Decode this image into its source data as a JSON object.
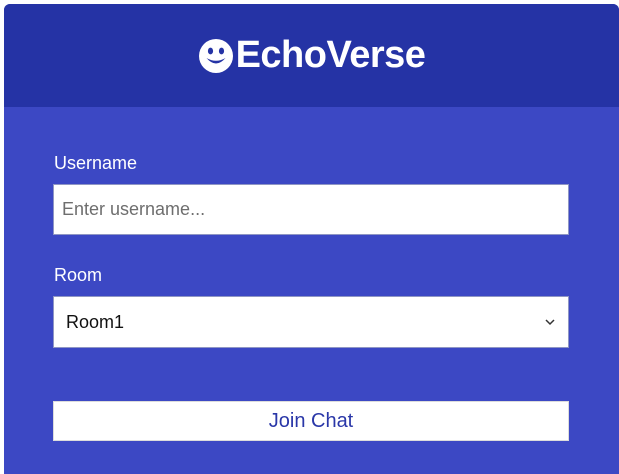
{
  "app": {
    "title": "EchoVerse",
    "logo_icon": "smiley-face-icon"
  },
  "form": {
    "username": {
      "label": "Username",
      "placeholder": "Enter username...",
      "value": ""
    },
    "room": {
      "label": "Room",
      "selected": "Room1",
      "dropdown_icon": "chevron-down-icon"
    },
    "join_label": "Join Chat"
  },
  "colors": {
    "header": "#2533a5",
    "body": "#3c48c4",
    "text": "#ffffff",
    "button_text": "#2a37a8"
  }
}
